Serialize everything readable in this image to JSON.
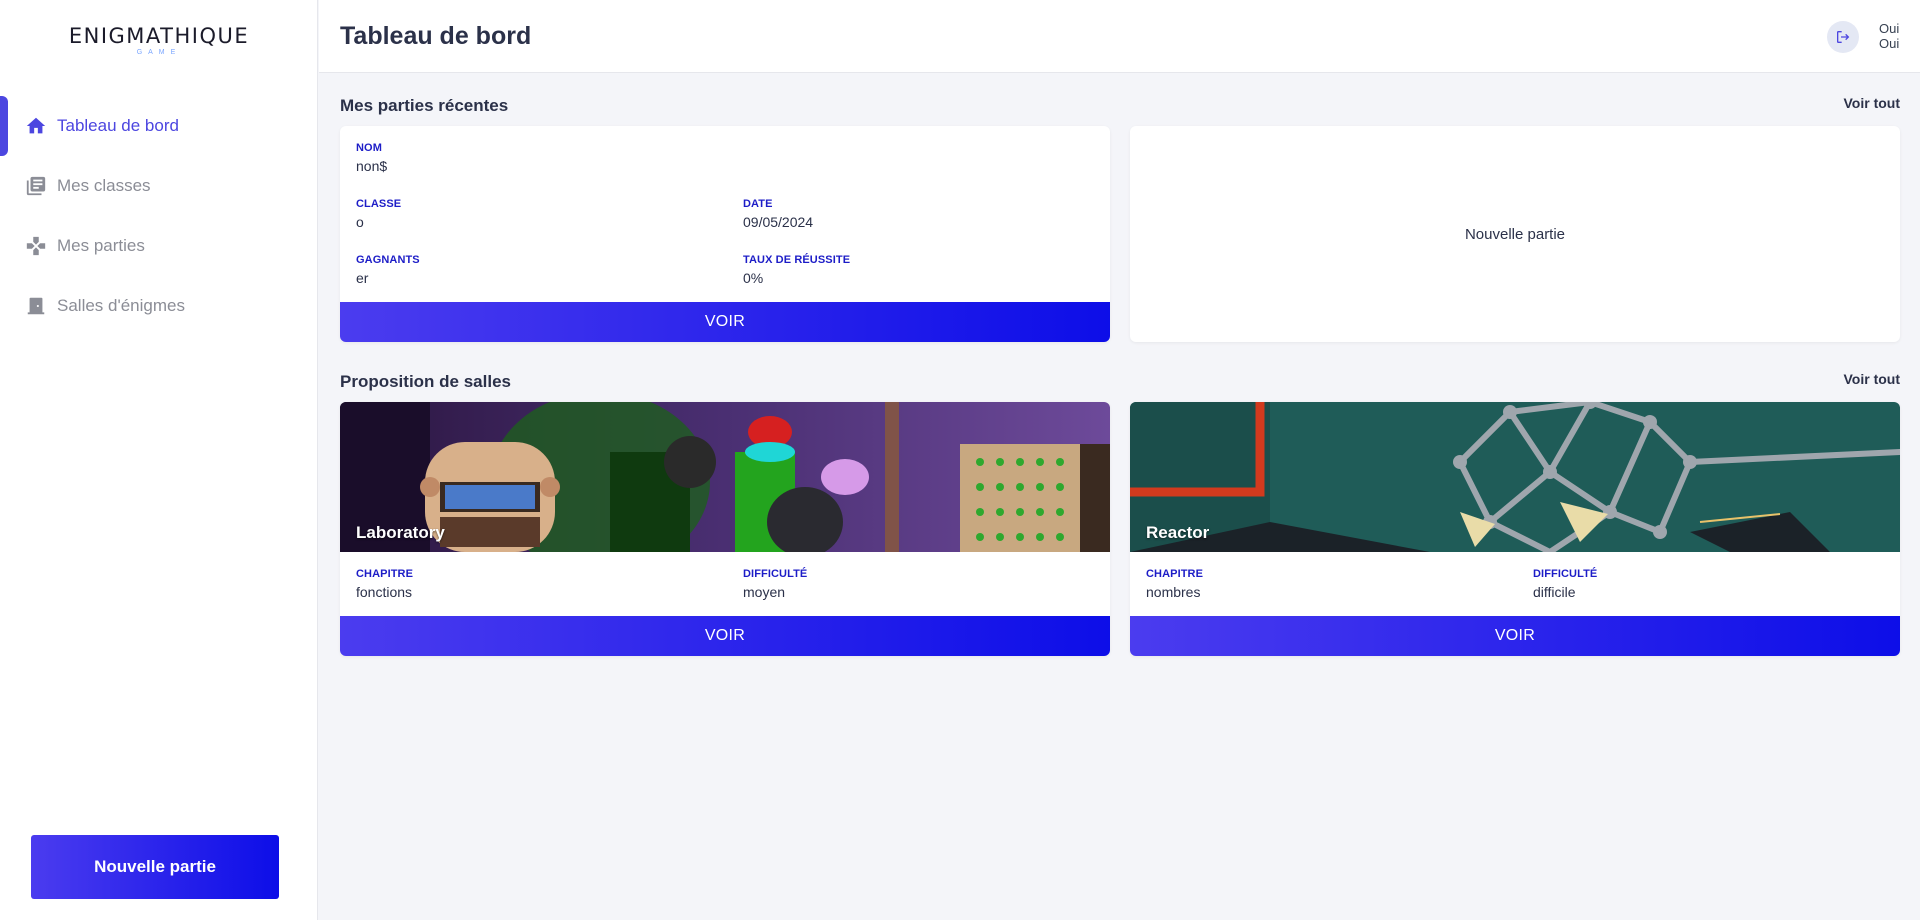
{
  "logo": {
    "name": "ENIGMATHIQUE",
    "sub": "GAME"
  },
  "sidebar": {
    "items": [
      {
        "label": "Tableau de bord",
        "icon": "home-icon",
        "active": true
      },
      {
        "label": "Mes classes",
        "icon": "library-icon",
        "active": false
      },
      {
        "label": "Mes parties",
        "icon": "gamepad-icon",
        "active": false
      },
      {
        "label": "Salles d'énigmes",
        "icon": "door-icon",
        "active": false
      }
    ],
    "new_game_label": "Nouvelle partie"
  },
  "header": {
    "title": "Tableau de bord",
    "user_line1": "Oui",
    "user_line2": "Oui"
  },
  "recent": {
    "title": "Mes parties récentes",
    "see_all": "Voir tout",
    "game": {
      "name_label": "NOM",
      "name": "non$",
      "class_label": "CLASSE",
      "class": "o",
      "date_label": "DATE",
      "date": "09/05/2024",
      "winners_label": "GAGNANTS",
      "winners": "er",
      "rate_label": "TAUX DE RÉUSSITE",
      "rate": "0%",
      "button": "VOIR"
    },
    "new_card_label": "Nouvelle partie"
  },
  "rooms": {
    "title": "Proposition de salles",
    "see_all": "Voir tout",
    "items": [
      {
        "name": "Laboratory",
        "chapter_label": "CHAPITRE",
        "chapter": "fonctions",
        "difficulty_label": "DIFFICULTÉ",
        "difficulty": "moyen",
        "button": "VOIR"
      },
      {
        "name": "Reactor",
        "chapter_label": "CHAPITRE",
        "chapter": "nombres",
        "difficulty_label": "DIFFICULTÉ",
        "difficulty": "difficile",
        "button": "VOIR"
      }
    ]
  },
  "colors": {
    "accent": "#4c46e0",
    "button_gradient_start": "#4b3cef",
    "button_gradient_end": "#0d0ee8",
    "label_blue": "#1d1dc7"
  }
}
